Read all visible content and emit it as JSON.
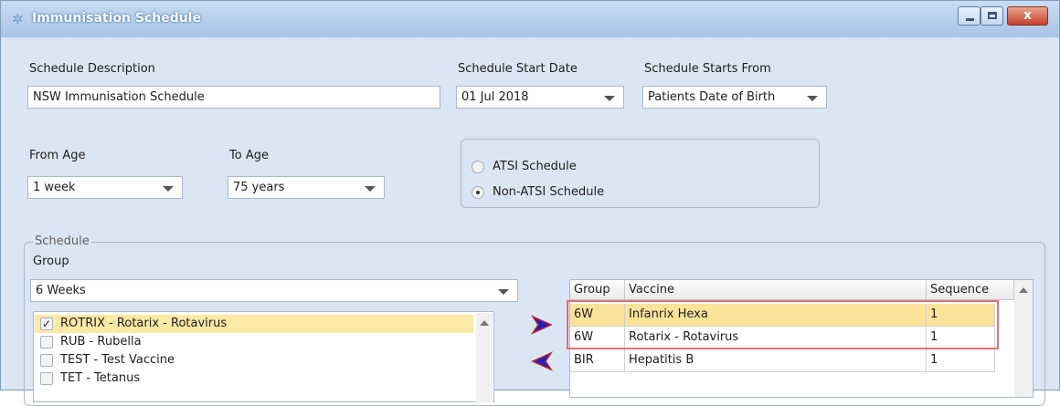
{
  "window": {
    "title": "Immunisation Schedule",
    "close_glyph": "x",
    "icons": [
      "app-icon",
      "minimize-icon",
      "maximize-icon",
      "close-icon"
    ]
  },
  "form": {
    "description_label": "Schedule Description",
    "description_value": "NSW Immunisation Schedule",
    "start_date_label": "Schedule Start Date",
    "start_date_value": "01 Jul 2018",
    "starts_from_label": "Schedule Starts From",
    "starts_from_value": "Patients Date of Birth",
    "from_age_label": "From Age",
    "from_age_value": "1 week",
    "to_age_label": "To Age",
    "to_age_value": "75 years",
    "atsi_label": "ATSI Schedule",
    "non_atsi_label": "Non-ATSI Schedule",
    "selected_radio": "Non-ATSI Schedule"
  },
  "schedule": {
    "legend": "Schedule",
    "group_label": "Group",
    "group_value": "6 Weeks",
    "vaccine_list": [
      {
        "label": "ROTRIX - Rotarix - Rotavirus",
        "checked": true,
        "check_glyph": "✓"
      },
      {
        "label": "RUB - Rubella",
        "checked": false
      },
      {
        "label": "TEST - Test Vaccine",
        "checked": false
      },
      {
        "label": "TET - Tetanus",
        "checked": false
      }
    ],
    "grid": {
      "headers": [
        "Group",
        "Vaccine",
        "Sequence"
      ],
      "rows": [
        {
          "group": "6W",
          "vaccine": "Infanrix Hexa",
          "sequence": "1"
        },
        {
          "group": "6W",
          "vaccine": "Rotarix - Rotavirus",
          "sequence": "1"
        },
        {
          "group": "BIR",
          "vaccine": "Hepatitis B",
          "sequence": "1"
        }
      ]
    }
  },
  "colors": {
    "window_bg": "#dbe6f4",
    "selection": "#fce39a",
    "add_arrow": "#2020c0",
    "remove_arrow": "#2020c0",
    "highlight_outline": "#e0707a"
  }
}
